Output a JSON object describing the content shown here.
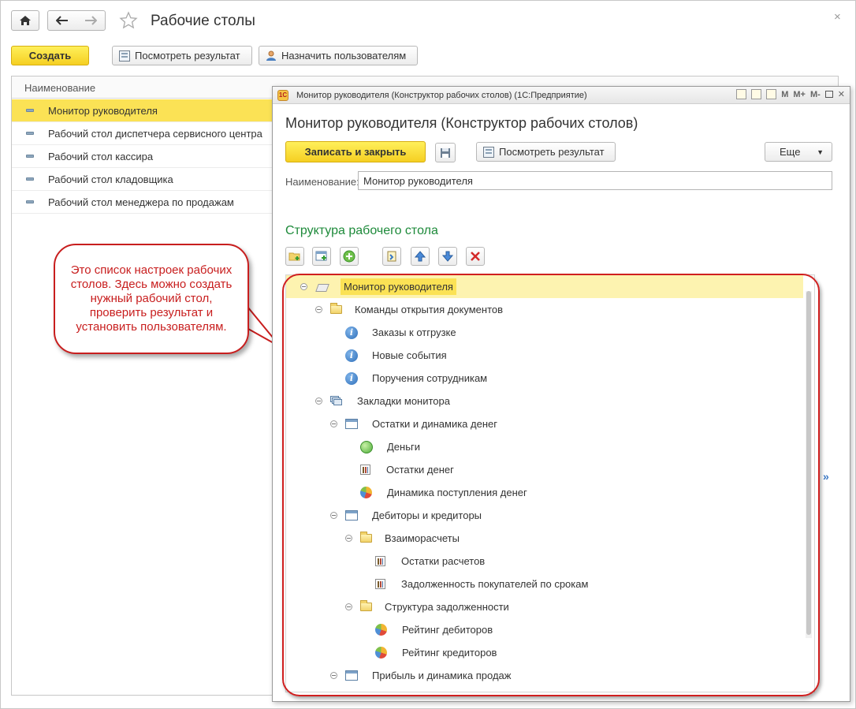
{
  "header": {
    "title": "Рабочие столы",
    "close_glyph": "×",
    "home_icon": "home-icon",
    "back_icon": "arrow-left-icon",
    "forward_icon": "arrow-right-icon",
    "favorite_icon": "star-icon"
  },
  "toolbar": {
    "create_label": "Создать",
    "view_result_label": "Посмотреть результат",
    "assign_users_label": "Назначить пользователям"
  },
  "list": {
    "column_header": "Наименование",
    "items": [
      {
        "label": "Монитор руководителя",
        "selected": true
      },
      {
        "label": "Рабочий стол диспетчера сервисного центра"
      },
      {
        "label": "Рабочий стол кассира"
      },
      {
        "label": "Рабочий стол кладовщика"
      },
      {
        "label": "Рабочий стол менеджера по продажам"
      }
    ]
  },
  "callout": {
    "text": "Это список настроек рабочих столов. Здесь можно создать нужный рабочий стол, проверить результат и установить пользователям."
  },
  "window": {
    "titlebar": "Монитор руководителя (Конструктор рабочих столов)  (1С:Предприятие)",
    "titlebar_buttons": [
      "M",
      "M+",
      "M-"
    ],
    "heading": "Монитор руководителя (Конструктор рабочих столов)",
    "save_close_label": "Записать и закрыть",
    "view_result_label": "Посмотреть результат",
    "more_label": "Еще",
    "more_arrow": "▼",
    "name_label": "Наименование:",
    "name_value": "Монитор руководителя",
    "structure_title": "Структура рабочего стола",
    "expand_glyph": "»"
  },
  "tree": [
    {
      "label": "Монитор руководителя",
      "level": 0,
      "icon": "desktop-icon",
      "selected": true,
      "collapsible": true
    },
    {
      "label": "Команды открытия документов",
      "level": 1,
      "icon": "folder-icon",
      "collapsible": true
    },
    {
      "label": "Заказы к отгрузке",
      "level": 2,
      "icon": "info-icon"
    },
    {
      "label": "Новые события",
      "level": 2,
      "icon": "info-icon"
    },
    {
      "label": "Поручения сотрудникам",
      "level": 2,
      "icon": "info-icon"
    },
    {
      "label": "Закладки монитора",
      "level": 1,
      "icon": "tabs-icon",
      "collapsible": true
    },
    {
      "label": "Остатки и динамика денег",
      "level": 2,
      "icon": "window-icon",
      "collapsible": true
    },
    {
      "label": "Деньги",
      "level": 3,
      "icon": "green-circle-icon"
    },
    {
      "label": "Остатки денег",
      "level": 3,
      "icon": "chart-icon"
    },
    {
      "label": "Динамика поступления денег",
      "level": 3,
      "icon": "pie-chart-icon"
    },
    {
      "label": "Дебиторы и кредиторы",
      "level": 2,
      "icon": "window-icon",
      "collapsible": true
    },
    {
      "label": "Взаиморасчеты",
      "level": 3,
      "icon": "folder-icon",
      "collapsible": true
    },
    {
      "label": "Остатки расчетов",
      "level": 4,
      "icon": "chart-icon"
    },
    {
      "label": "Задолженность покупателей по срокам",
      "level": 4,
      "icon": "chart-icon"
    },
    {
      "label": "Структура задолженности",
      "level": 3,
      "icon": "folder-icon",
      "collapsible": true
    },
    {
      "label": "Рейтинг дебиторов",
      "level": 4,
      "icon": "pie-chart-icon"
    },
    {
      "label": "Рейтинг кредиторов",
      "level": 4,
      "icon": "pie-chart-icon"
    },
    {
      "label": "Прибыль и динамика продаж",
      "level": 2,
      "icon": "window-icon",
      "collapsible": true
    }
  ],
  "colors": {
    "accent_yellow": "#f5cf22",
    "selection": "#fbe255",
    "section_green": "#1d8a3a",
    "callout_red": "#c81e1e"
  }
}
